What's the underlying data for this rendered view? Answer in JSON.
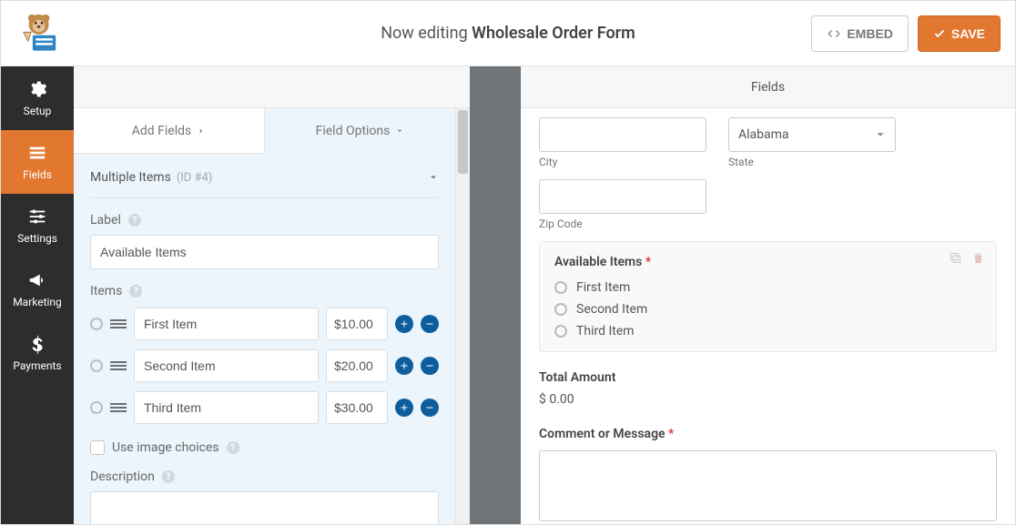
{
  "header": {
    "prefix": "Now editing",
    "title": "Wholesale Order Form",
    "embed_label": "EMBED",
    "save_label": "SAVE"
  },
  "sidenav": {
    "setup": "Setup",
    "fields": "Fields",
    "settings": "Settings",
    "marketing": "Marketing",
    "payments": "Payments"
  },
  "subheader": {
    "title": "Fields"
  },
  "tabs": {
    "add_fields": "Add Fields",
    "field_options": "Field Options"
  },
  "panel": {
    "group_title": "Multiple Items",
    "group_meta": "(ID #4)",
    "label_heading": "Label",
    "label_value": "Available Items",
    "items_heading": "Items",
    "items": [
      {
        "name": "First Item",
        "price": "$10.00"
      },
      {
        "name": "Second Item",
        "price": "$20.00"
      },
      {
        "name": "Third Item",
        "price": "$30.00"
      }
    ],
    "image_choices": "Use image choices",
    "description_heading": "Description"
  },
  "preview": {
    "state_value": "Alabama",
    "city_label": "City",
    "state_label": "State",
    "zip_label": "Zip Code",
    "available_title": "Available Items",
    "radio_items": [
      "First Item",
      "Second Item",
      "Third Item"
    ],
    "total_title": "Total Amount",
    "total_value": "$ 0.00",
    "comment_title": "Comment or Message"
  }
}
